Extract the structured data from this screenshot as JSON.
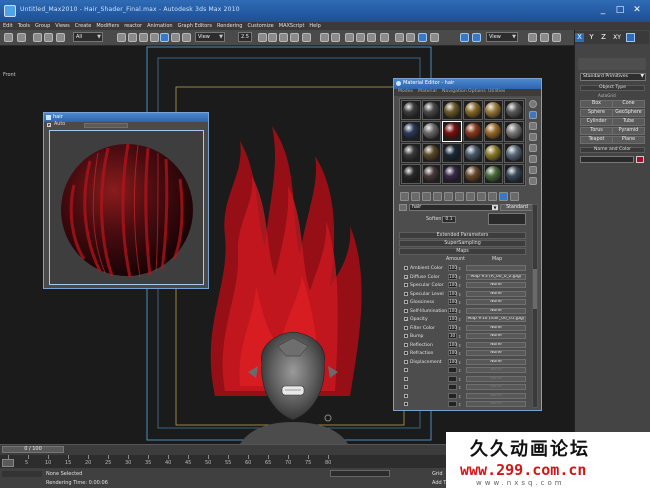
{
  "app": {
    "title": "Untitled_Max2010 - Hair_Shader_Final.max - Autodesk 3ds Max 2010",
    "window_controls": [
      "_",
      "□",
      "✕"
    ]
  },
  "menu": [
    "Edit",
    "Tools",
    "Group",
    "Views",
    "Create",
    "Modifiers",
    "reactor",
    "Animation",
    "Graph Editors",
    "Rendering",
    "Customize",
    "MAXScript",
    "Help"
  ],
  "toolbar": {
    "filter_dropdown": "All",
    "refcoord_dropdown": "View",
    "spinner_value": "2.5",
    "named_sel_dropdown": "View"
  },
  "viewport": {
    "label": "Front"
  },
  "command_panel": {
    "category_dropdown": "Standard Primitives",
    "rollout_object_type": "Object Type",
    "autogrid_label": "AutoGrid",
    "buttons": [
      "Box",
      "Cone",
      "Sphere",
      "GeoSphere",
      "Cylinder",
      "Tube",
      "Torus",
      "Pyramid",
      "Teapot",
      "Plane"
    ],
    "rollout_name_color": "Name and Color",
    "axis_labels": [
      "X",
      "Y",
      "Z",
      "XY"
    ]
  },
  "sphere_window": {
    "title": "hair",
    "auto_label": "Auto"
  },
  "material_editor": {
    "title": "Material Editor - hair",
    "menu": [
      "Modes",
      "Material",
      "Navigation",
      "Options",
      "Utilities"
    ],
    "material_name": "hair",
    "material_type": "Standard",
    "soften_label": "Soften:",
    "soften_value": "0.1",
    "rollouts": [
      "Extended Parameters",
      "SuperSampling",
      "Maps"
    ],
    "maps_headers": {
      "amount": "Amount",
      "map": "Map"
    },
    "maps": [
      {
        "label": "Ambient Color",
        "checked": false,
        "amount": "100",
        "map": ""
      },
      {
        "label": "Diffuse Color",
        "checked": true,
        "amount": "100",
        "map": "Map #3 (R_00_0_2.jpg)"
      },
      {
        "label": "Specular Color",
        "checked": false,
        "amount": "100",
        "map": "None"
      },
      {
        "label": "Specular Level",
        "checked": false,
        "amount": "100",
        "map": "None"
      },
      {
        "label": "Glossiness",
        "checked": false,
        "amount": "100",
        "map": "None"
      },
      {
        "label": "Self-Illumination",
        "checked": false,
        "amount": "100",
        "map": "None"
      },
      {
        "label": "Opacity",
        "checked": true,
        "amount": "100",
        "map": "Map #10 (hair_00_01.jpg)"
      },
      {
        "label": "Filter Color",
        "checked": false,
        "amount": "100",
        "map": "None"
      },
      {
        "label": "Bump",
        "checked": false,
        "amount": "30",
        "map": "None"
      },
      {
        "label": "Reflection",
        "checked": false,
        "amount": "100",
        "map": "None"
      },
      {
        "label": "Refraction",
        "checked": false,
        "amount": "100",
        "map": "None"
      },
      {
        "label": "Displacement",
        "checked": false,
        "amount": "100",
        "map": "None"
      },
      {
        "label": "",
        "checked": false,
        "amount": "",
        "map": "None"
      },
      {
        "label": "",
        "checked": false,
        "amount": "",
        "map": "None"
      },
      {
        "label": "",
        "checked": false,
        "amount": "",
        "map": "None"
      },
      {
        "label": "",
        "checked": false,
        "amount": "",
        "map": "None"
      },
      {
        "label": "",
        "checked": false,
        "amount": "",
        "map": "None"
      }
    ]
  },
  "time": {
    "slider_label": "0 / 100",
    "ticks": [
      "0",
      "5",
      "10",
      "15",
      "20",
      "25",
      "30",
      "35",
      "40",
      "45",
      "50",
      "55",
      "60",
      "65",
      "70",
      "75",
      "80"
    ]
  },
  "status": {
    "selection": "None Selected",
    "render_time": "Rendering Time: 0:00:06",
    "grid": "Grid",
    "add_time_tag": "Add Time Tag"
  },
  "watermark": {
    "line1": "久久动画论坛",
    "line2": "www.299.com.cn",
    "line3": "www.nxsq.com"
  },
  "colors": {
    "hair": "#b5141b",
    "window_border": "#78a2d4",
    "frame_blue": "#4a8fbf",
    "frame_gold": "#b8a04a"
  }
}
